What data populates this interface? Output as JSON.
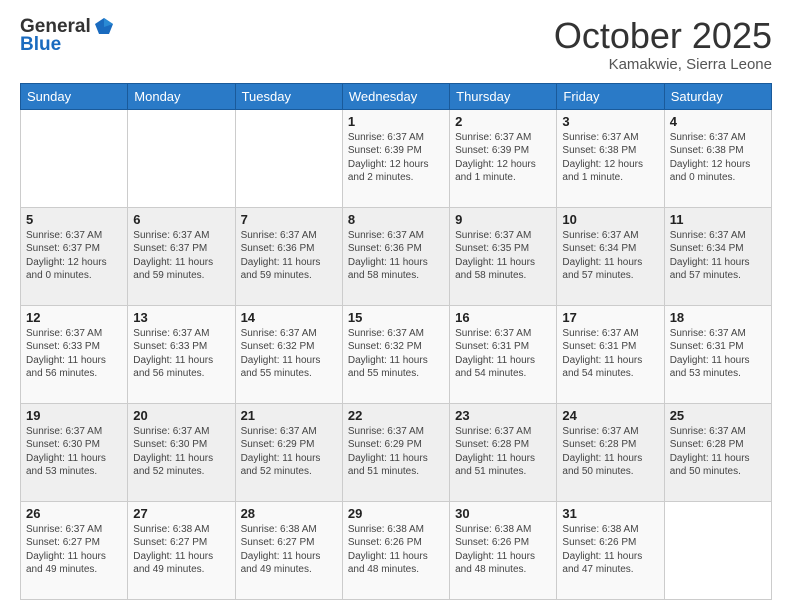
{
  "header": {
    "logo_line1": "General",
    "logo_line2": "Blue",
    "month": "October 2025",
    "location": "Kamakwie, Sierra Leone"
  },
  "weekdays": [
    "Sunday",
    "Monday",
    "Tuesday",
    "Wednesday",
    "Thursday",
    "Friday",
    "Saturday"
  ],
  "weeks": [
    [
      {
        "day": "",
        "info": ""
      },
      {
        "day": "",
        "info": ""
      },
      {
        "day": "",
        "info": ""
      },
      {
        "day": "1",
        "info": "Sunrise: 6:37 AM\nSunset: 6:39 PM\nDaylight: 12 hours\nand 2 minutes."
      },
      {
        "day": "2",
        "info": "Sunrise: 6:37 AM\nSunset: 6:39 PM\nDaylight: 12 hours\nand 1 minute."
      },
      {
        "day": "3",
        "info": "Sunrise: 6:37 AM\nSunset: 6:38 PM\nDaylight: 12 hours\nand 1 minute."
      },
      {
        "day": "4",
        "info": "Sunrise: 6:37 AM\nSunset: 6:38 PM\nDaylight: 12 hours\nand 0 minutes."
      }
    ],
    [
      {
        "day": "5",
        "info": "Sunrise: 6:37 AM\nSunset: 6:37 PM\nDaylight: 12 hours\nand 0 minutes."
      },
      {
        "day": "6",
        "info": "Sunrise: 6:37 AM\nSunset: 6:37 PM\nDaylight: 11 hours\nand 59 minutes."
      },
      {
        "day": "7",
        "info": "Sunrise: 6:37 AM\nSunset: 6:36 PM\nDaylight: 11 hours\nand 59 minutes."
      },
      {
        "day": "8",
        "info": "Sunrise: 6:37 AM\nSunset: 6:36 PM\nDaylight: 11 hours\nand 58 minutes."
      },
      {
        "day": "9",
        "info": "Sunrise: 6:37 AM\nSunset: 6:35 PM\nDaylight: 11 hours\nand 58 minutes."
      },
      {
        "day": "10",
        "info": "Sunrise: 6:37 AM\nSunset: 6:34 PM\nDaylight: 11 hours\nand 57 minutes."
      },
      {
        "day": "11",
        "info": "Sunrise: 6:37 AM\nSunset: 6:34 PM\nDaylight: 11 hours\nand 57 minutes."
      }
    ],
    [
      {
        "day": "12",
        "info": "Sunrise: 6:37 AM\nSunset: 6:33 PM\nDaylight: 11 hours\nand 56 minutes."
      },
      {
        "day": "13",
        "info": "Sunrise: 6:37 AM\nSunset: 6:33 PM\nDaylight: 11 hours\nand 56 minutes."
      },
      {
        "day": "14",
        "info": "Sunrise: 6:37 AM\nSunset: 6:32 PM\nDaylight: 11 hours\nand 55 minutes."
      },
      {
        "day": "15",
        "info": "Sunrise: 6:37 AM\nSunset: 6:32 PM\nDaylight: 11 hours\nand 55 minutes."
      },
      {
        "day": "16",
        "info": "Sunrise: 6:37 AM\nSunset: 6:31 PM\nDaylight: 11 hours\nand 54 minutes."
      },
      {
        "day": "17",
        "info": "Sunrise: 6:37 AM\nSunset: 6:31 PM\nDaylight: 11 hours\nand 54 minutes."
      },
      {
        "day": "18",
        "info": "Sunrise: 6:37 AM\nSunset: 6:31 PM\nDaylight: 11 hours\nand 53 minutes."
      }
    ],
    [
      {
        "day": "19",
        "info": "Sunrise: 6:37 AM\nSunset: 6:30 PM\nDaylight: 11 hours\nand 53 minutes."
      },
      {
        "day": "20",
        "info": "Sunrise: 6:37 AM\nSunset: 6:30 PM\nDaylight: 11 hours\nand 52 minutes."
      },
      {
        "day": "21",
        "info": "Sunrise: 6:37 AM\nSunset: 6:29 PM\nDaylight: 11 hours\nand 52 minutes."
      },
      {
        "day": "22",
        "info": "Sunrise: 6:37 AM\nSunset: 6:29 PM\nDaylight: 11 hours\nand 51 minutes."
      },
      {
        "day": "23",
        "info": "Sunrise: 6:37 AM\nSunset: 6:28 PM\nDaylight: 11 hours\nand 51 minutes."
      },
      {
        "day": "24",
        "info": "Sunrise: 6:37 AM\nSunset: 6:28 PM\nDaylight: 11 hours\nand 50 minutes."
      },
      {
        "day": "25",
        "info": "Sunrise: 6:37 AM\nSunset: 6:28 PM\nDaylight: 11 hours\nand 50 minutes."
      }
    ],
    [
      {
        "day": "26",
        "info": "Sunrise: 6:37 AM\nSunset: 6:27 PM\nDaylight: 11 hours\nand 49 minutes."
      },
      {
        "day": "27",
        "info": "Sunrise: 6:38 AM\nSunset: 6:27 PM\nDaylight: 11 hours\nand 49 minutes."
      },
      {
        "day": "28",
        "info": "Sunrise: 6:38 AM\nSunset: 6:27 PM\nDaylight: 11 hours\nand 49 minutes."
      },
      {
        "day": "29",
        "info": "Sunrise: 6:38 AM\nSunset: 6:26 PM\nDaylight: 11 hours\nand 48 minutes."
      },
      {
        "day": "30",
        "info": "Sunrise: 6:38 AM\nSunset: 6:26 PM\nDaylight: 11 hours\nand 48 minutes."
      },
      {
        "day": "31",
        "info": "Sunrise: 6:38 AM\nSunset: 6:26 PM\nDaylight: 11 hours\nand 47 minutes."
      },
      {
        "day": "",
        "info": ""
      }
    ]
  ]
}
